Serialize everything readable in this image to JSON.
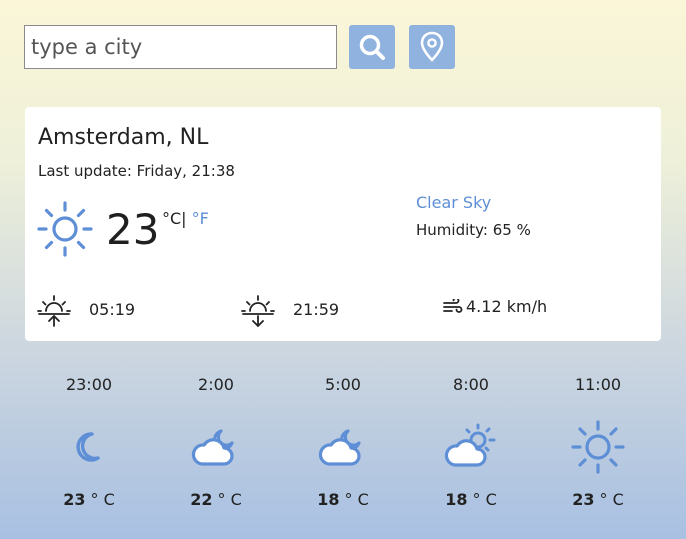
{
  "search": {
    "placeholder": "type a city",
    "value": ""
  },
  "buttons": {
    "search_icon": "search-icon",
    "location_icon": "map-pin-icon"
  },
  "current": {
    "city": "Amsterdam, NL",
    "last_update": "Last update: Friday, 21:38",
    "temperature": "23",
    "unit_c": "°C|",
    "unit_f": " °F",
    "description": "Clear Sky",
    "humidity_label": "Humidity: ",
    "humidity_value": "65 %",
    "sunrise": "05:19",
    "sunset": "21:59",
    "wind": "4.12 km/h",
    "icon": "sun-icon"
  },
  "forecast": [
    {
      "time": "23:00",
      "temp_value": "23",
      "temp_unit": "° C",
      "icon": "moon-icon"
    },
    {
      "time": "2:00",
      "temp_value": "22",
      "temp_unit": "° C",
      "icon": "cloud-moon-icon"
    },
    {
      "time": "5:00",
      "temp_value": "18",
      "temp_unit": "° C",
      "icon": "cloud-moon-icon"
    },
    {
      "time": "8:00",
      "temp_value": "18",
      "temp_unit": "° C",
      "icon": "cloud-sun-icon"
    },
    {
      "time": "11:00",
      "temp_value": "23",
      "temp_unit": "° C",
      "icon": "sun-icon"
    }
  ],
  "colors": {
    "accent": "#5e8fd6",
    "button_bg": "#8fb2de"
  }
}
